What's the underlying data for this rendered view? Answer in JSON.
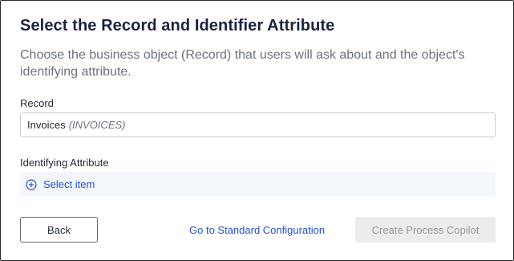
{
  "dialog": {
    "title": "Select the Record and Identifier Attribute",
    "subtitle": "Choose the business object (Record) that users will ask about and the object's identifying attribute."
  },
  "record": {
    "label": "Record",
    "value": "Invoices",
    "code": "(INVOICES)"
  },
  "identifying_attribute": {
    "label": "Identifying Attribute",
    "select_label": "Select item",
    "icon": "plus-circle-icon"
  },
  "footer": {
    "back_label": "Back",
    "standard_link": "Go to Standard Configuration",
    "create_label": "Create Process Copilot"
  },
  "colors": {
    "title": "#1a2340",
    "link": "#2451c9",
    "select_bg": "#f3f7fc",
    "disabled_bg": "#ececec",
    "disabled_text": "#9a9a9a"
  }
}
